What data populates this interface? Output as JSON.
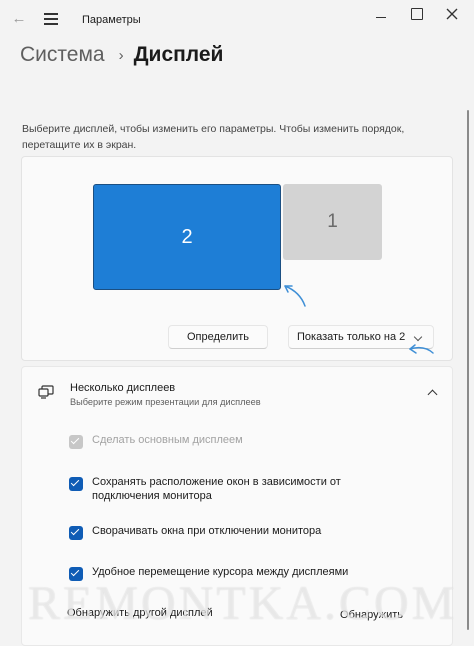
{
  "window": {
    "title": "Параметры",
    "back_icon": "arrow-left",
    "menu_icon": "hamburger",
    "controls": [
      "minimize",
      "maximize",
      "close"
    ]
  },
  "breadcrumb": {
    "parent": "Система",
    "separator": "›",
    "current": "Дисплей"
  },
  "arrangement": {
    "description": "Выберите дисплей, чтобы изменить его параметры. Чтобы изменить порядок, перетащите их в экран.",
    "monitors": [
      {
        "label": "2",
        "selected": true,
        "color": "#1e7ed6"
      },
      {
        "label": "1",
        "selected": false,
        "color": "#d3d3d3"
      }
    ],
    "identify_label": "Определить",
    "show_only_value": "Показать только на 2"
  },
  "multiple_displays": {
    "title": "Несколько дисплеев",
    "subtitle": "Выберите режим презентации для дисплеев",
    "expanded": true,
    "options": [
      {
        "label": "Сделать основным дисплеем",
        "checked": true,
        "disabled": true
      },
      {
        "label": "Сохранять расположение окон в зависимости от подключения монитора",
        "checked": true,
        "disabled": false
      },
      {
        "label": "Сворачивать окна при отключении монитора",
        "checked": true,
        "disabled": false
      },
      {
        "label": "Удобное перемещение курсора между дисплеями",
        "checked": true,
        "disabled": false
      }
    ],
    "detect_other_label": "Обнаружить другой дисплей",
    "detect_label": "Обнаружить"
  },
  "watermark": "REMONTKA.COM",
  "colors": {
    "accent": "#0f5cb5",
    "selected_monitor": "#1e7ed6",
    "annotation_arrow": "#3f8fd6",
    "background": "#f3f3f3"
  }
}
